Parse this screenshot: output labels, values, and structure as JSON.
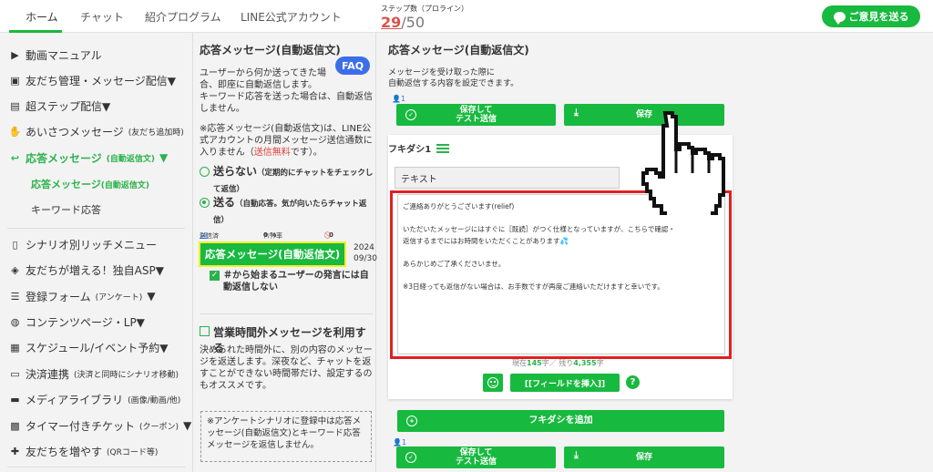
{
  "topnav": {
    "tabs": [
      "ホーム",
      "チャット",
      "紹介プログラム",
      "LINE公式アカウント"
    ],
    "steps_label": "ステップ数（プロライン）",
    "steps_current": "29",
    "steps_total": "/50",
    "feedback_label": "ご意見を送る"
  },
  "sidebar": {
    "items": [
      {
        "label": "動画マニュアル",
        "icon": "video-icon"
      },
      {
        "label": "友だち管理・メッセージ配信▼",
        "icon": "contacts-icon"
      },
      {
        "label": "超ステップ配信▼",
        "icon": "steps-icon"
      },
      {
        "label": "あいさつメッセージ",
        "small": "(友だち追加時)",
        "icon": "wave-hand-icon"
      },
      {
        "label": "応答メッセージ",
        "small": "(自動返信文)",
        "suffix": "▼",
        "icon": "reply-icon"
      },
      {
        "label": "シナリオ別リッチメニュー",
        "icon": "phone-icon"
      },
      {
        "label": "友だちが増える！独自ASP▼",
        "icon": "handshake-icon"
      },
      {
        "label": "登録フォーム",
        "small": "(アンケート)",
        "suffix": "▼",
        "icon": "list-icon"
      },
      {
        "label": "コンテンツページ・LP▼",
        "icon": "globe-icon"
      },
      {
        "label": "スケジュール/イベント予約▼",
        "icon": "calendar-icon"
      },
      {
        "label": "決済連携",
        "small": "(決済と同時にシナリオ移動)",
        "icon": "card-icon"
      },
      {
        "label": "メディアライブラリ",
        "small": "(画像/動画/他)",
        "icon": "folder-icon"
      },
      {
        "label": "タイマー付きチケット",
        "small": "(クーポン)",
        "suffix": "▼",
        "icon": "ticket-icon"
      },
      {
        "label": "友だちを増やす",
        "small": "(QRコード等)",
        "icon": "add-user-icon"
      }
    ],
    "sub": [
      {
        "label": "応答メッセージ",
        "small": "(自動返信文)"
      },
      {
        "label": "キーワード応答"
      }
    ]
  },
  "middle": {
    "title": "応答メッセージ(自動返信文)",
    "faq": "FAQ",
    "desc1": "ユーザーから何か送ってきた場合、即座に自動返信します。",
    "desc2": "キーワード応答を送った場合は、自動返信しません。",
    "note_pre": "※応答メッセージ(自動返信文)は、LINE公式アカウントの月間メッセージ送信通数に入りません（",
    "note_red": "送信無料",
    "note_post": "です）。",
    "radio_off_label": "送らない",
    "radio_off_note": "（定期的にチャットをチェックして返信）",
    "radio_on_label": "送る",
    "radio_on_note": "（自動応答。気が向いたらチャット返信）",
    "stats": {
      "sent_label": "送信済",
      "sent_value": "19",
      "click_label": "ｸﾘｯｸ率",
      "click_value": "0 %",
      "block_value": "0"
    },
    "active_msg": "応答メッセージ(自動返信文)",
    "date_line1": "2024",
    "date_line2": "09/30",
    "hash_check": "＃から始まるユーザーの発言には自動返信しない",
    "ooh_title": "営業時間外メッセージを利用する",
    "ooh_desc": "決められた時間外に、別の内容のメッセージを返送します。深夜など、チャットを返すことができない時間帯だけ、設定するのもオススメです。",
    "scenario_note": "※アンケートシナリオに登録中は応答メッセージ(自動返信文)とキーワード応答メッセージを返信しません。"
  },
  "right": {
    "title": "応答メッセージ(自動返信文)",
    "desc_line1": "メッセージを受け取った際に",
    "desc_line2": "自動返信する内容を設定できます。",
    "person_count": "1",
    "save_test_line1": "保存して",
    "save_test_line2": "テスト送信",
    "save": "保存",
    "fukidashi": "フキダシ1",
    "type_value": "テキスト",
    "message_lines": [
      "ご連絡ありがとうございます(relief)",
      "",
      "いただいたメッセージにはすぐに［既読］がつく仕様となっていますが、こちらで確認・",
      "返信するまでにはお時間をいただくことがあります💦",
      "",
      "あらかじめご了承くださいませ。",
      "",
      "※3日経っても返信がない場合は、お手数ですが再度ご連絡いただけますと幸いです。"
    ],
    "counter_pre": "現在",
    "counter_cur": "145",
    "counter_mid": "字／ 残り",
    "counter_rest": "4,355",
    "counter_post": "字",
    "insert_field": "[[フィールドを挿入]]",
    "help": "?",
    "add_fukidashi": "フキダシを追加",
    "person_count2": "1"
  },
  "colors": {
    "accent": "#18b93f",
    "highlight": "#e02020",
    "faq": "#3b6ee8"
  }
}
